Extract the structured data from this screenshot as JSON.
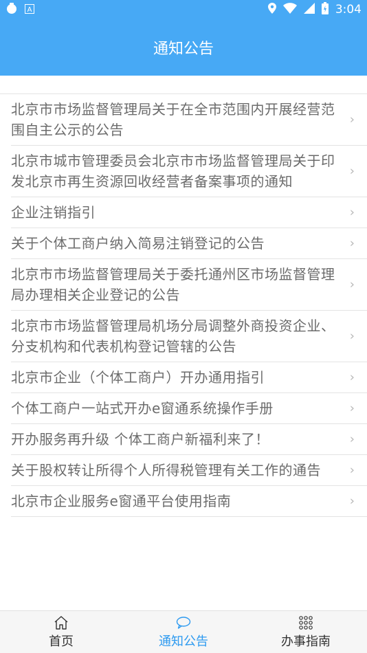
{
  "status_bar": {
    "time": "3:04",
    "left_icons": [
      "app-icon",
      "notification-a-icon"
    ],
    "right_icons": [
      "location-icon",
      "wifi-icon",
      "signal-icon",
      "battery-icon"
    ]
  },
  "header": {
    "title": "通知公告"
  },
  "notices": [
    {
      "title": "北京市市场监督管理局关于在全市范围内开展经营范围自主公示的公告"
    },
    {
      "title": "北京市城市管理委员会北京市市场监督管理局关于印发北京市再生资源回收经营者备案事项的通知"
    },
    {
      "title": "企业注销指引"
    },
    {
      "title": "关于个体工商户纳入简易注销登记的公告"
    },
    {
      "title": "北京市市场监督管理局关于委托通州区市场监督管理局办理相关企业登记的公告"
    },
    {
      "title": "北京市市场监督管理局机场分局调整外商投资企业、分支机构和代表机构登记管辖的公告"
    },
    {
      "title": "北京市企业（个体工商户）开办通用指引"
    },
    {
      "title": "个体工商户一站式开办e窗通系统操作手册"
    },
    {
      "title": "开办服务再升级 个体工商户新福利来了！"
    },
    {
      "title": "关于股权转让所得个人所得税管理有关工作的通告"
    },
    {
      "title": "北京市企业服务e窗通平台使用指南"
    }
  ],
  "chevron": "›",
  "tabbar": {
    "tabs": [
      {
        "label": "首页",
        "icon": "home-icon",
        "active": false
      },
      {
        "label": "通知公告",
        "icon": "chat-bubble-icon",
        "active": true
      },
      {
        "label": "办事指南",
        "icon": "grid-dots-icon",
        "active": false
      }
    ]
  },
  "colors": {
    "primary": "#47a9f5",
    "active_tab": "#2d9af0",
    "list_text": "#6b6b6b",
    "divider": "#e3e3e3"
  }
}
